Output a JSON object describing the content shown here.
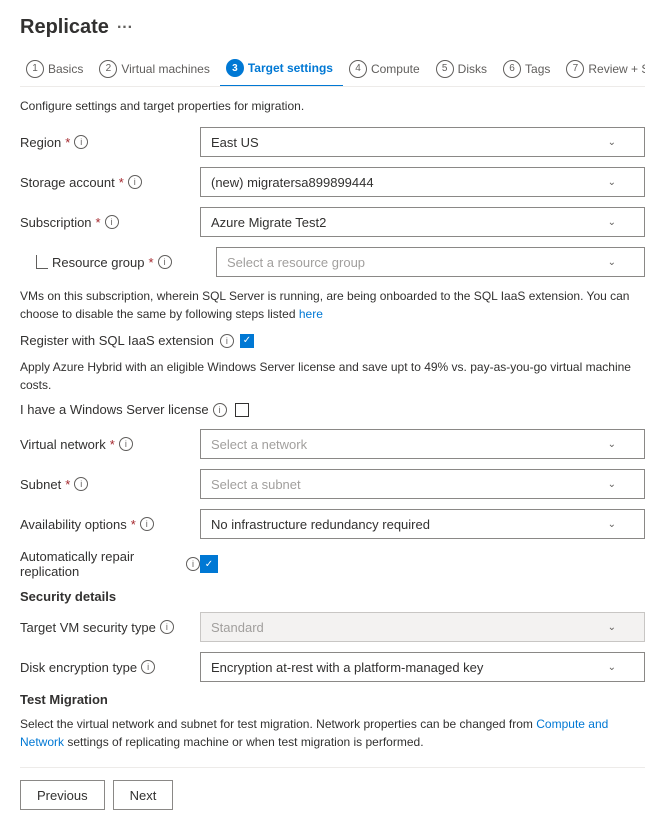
{
  "page": {
    "title": "Replicate",
    "ellipsis": "···"
  },
  "wizard": {
    "steps": [
      {
        "id": "basics",
        "number": "1",
        "label": "Basics",
        "active": false
      },
      {
        "id": "virtual-machines",
        "number": "2",
        "label": "Virtual machines",
        "active": false
      },
      {
        "id": "target-settings",
        "number": "3",
        "label": "Target settings",
        "active": true
      },
      {
        "id": "compute",
        "number": "4",
        "label": "Compute",
        "active": false
      },
      {
        "id": "disks",
        "number": "5",
        "label": "Disks",
        "active": false
      },
      {
        "id": "tags",
        "number": "6",
        "label": "Tags",
        "active": false
      },
      {
        "id": "review",
        "number": "7",
        "label": "Review + Start replication",
        "active": false
      }
    ]
  },
  "form": {
    "description": "Configure settings and target properties for migration.",
    "region": {
      "label": "Region",
      "required": true,
      "value": "East US"
    },
    "storage_account": {
      "label": "Storage account",
      "required": true,
      "value": "(new) migratersa899899444"
    },
    "subscription": {
      "label": "Subscription",
      "required": true,
      "value": "Azure Migrate Test2"
    },
    "resource_group": {
      "label": "Resource group",
      "required": true,
      "placeholder": "Select a resource group"
    },
    "sql_info": "VMs on this subscription, wherein SQL Server is running, are being onboarded to the SQL IaaS extension. You can choose to disable the same by following steps listed",
    "sql_link": "here",
    "sql_register_label": "Register with SQL IaaS extension",
    "apply_hybrid_text": "Apply Azure Hybrid with an eligible Windows Server license and save upt to 49% vs. pay-as-you-go virtual machine costs.",
    "windows_license_label": "I have a Windows Server license",
    "virtual_network": {
      "label": "Virtual network",
      "required": true,
      "placeholder": "Select a network"
    },
    "subnet": {
      "label": "Subnet",
      "required": true,
      "placeholder": "Select a subnet"
    },
    "availability_options": {
      "label": "Availability options",
      "required": true,
      "value": "No infrastructure redundancy required"
    },
    "auto_repair_label": "Automatically repair replication",
    "security_section": "Security details",
    "target_vm_security": {
      "label": "Target VM security type",
      "value": "Standard",
      "disabled": true
    },
    "disk_encryption": {
      "label": "Disk encryption type",
      "value": "Encryption at-rest with a platform-managed key"
    },
    "test_migration_section": "Test Migration",
    "test_migration_description": "Select the virtual network and subnet for test migration. Network properties can be changed from Compute and Network settings of replicating machine or when test migration is performed.",
    "test_migration_link1": "Compute and Network",
    "buttons": {
      "previous": "Previous",
      "next": "Next"
    }
  }
}
